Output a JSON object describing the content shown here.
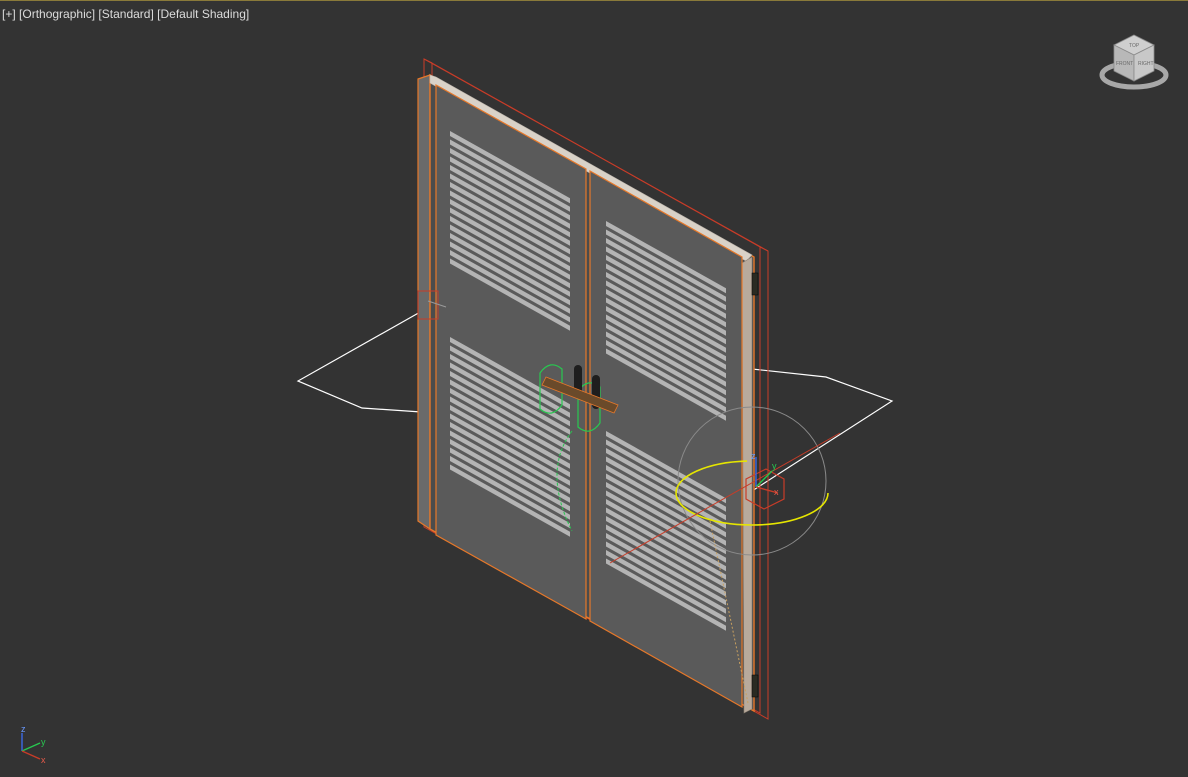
{
  "viewport": {
    "label_menu": {
      "plus": "[+]",
      "view": "[Orthographic]",
      "camera": "[Standard]",
      "shading": "[Default Shading]"
    },
    "background_color": "#333333"
  },
  "viewcube": {
    "faces": {
      "front": "FRONT",
      "right": "RIGHT",
      "top": "TOP"
    }
  },
  "tripod": {
    "x": "x",
    "y": "y",
    "z": "z"
  },
  "gizmo": {
    "x": "x",
    "y": "y",
    "z": "z"
  },
  "colors": {
    "selection_bbox": "#c83c28",
    "frame_highlight": "#e6782a",
    "door_panel": "#5a5a5a",
    "louver": "#b4b4b4",
    "wire_white": "#ffffff",
    "gizmo_yellow": "#e6e600",
    "handle_green": "#28c850"
  },
  "icons": [
    "viewcube-icon",
    "axis-tripod-icon",
    "move-gizmo-icon",
    "door-handle-icon",
    "hinge-icon"
  ]
}
